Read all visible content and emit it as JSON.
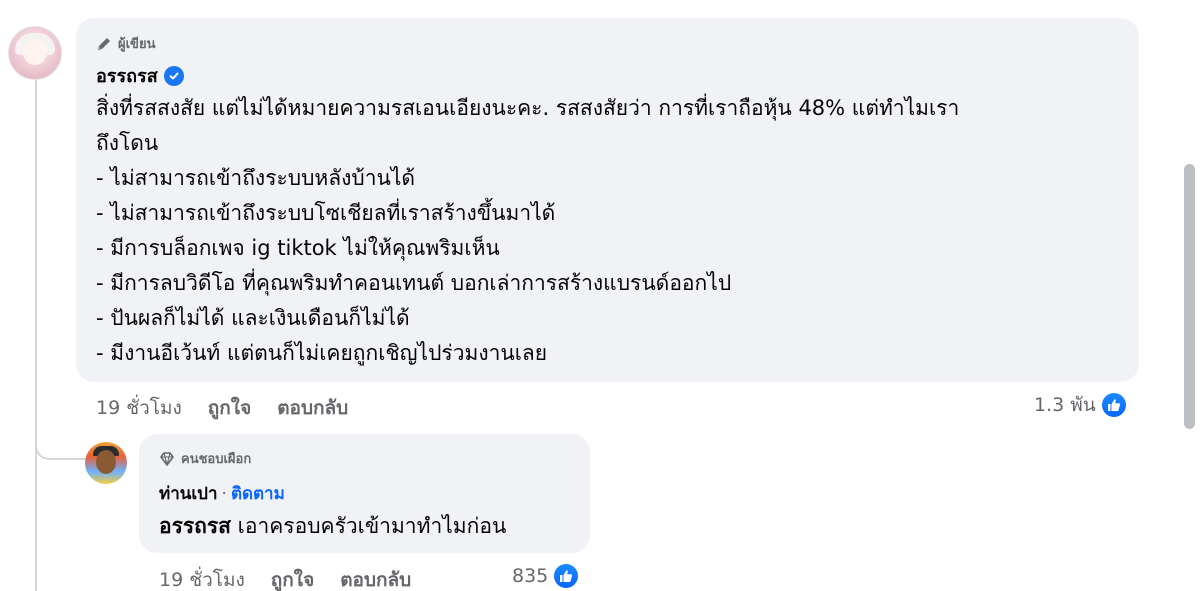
{
  "main_comment": {
    "badge": "ผู้เขียน",
    "author": "อรรถรส",
    "lines": [
      "สิ่งที่รสสงสัย แต่ไม่ได้หมายความรสเอนเอียงนะคะ. รสสงสัยว่า การที่เราถือหุ้น 48% แต่ทำไมเรา",
      "ถึงโดน",
      "- ไม่สามารถเข้าถึงระบบหลังบ้านได้",
      "- ไม่สามารถเข้าถึงระบบโซเชียลที่เราสร้างขึ้นมาได้",
      "- มีการบล็อกเพจ ig tiktok ไม่ให้คุณพริมเห็น",
      "- มีการลบวิดีโอ ที่คุณพริมทำคอนเทนต์ บอกเล่าการสร้างแบรนด์ออกไป",
      "- ปันผลก็ไม่ได้ และเงินเดือนก็ไม่ได้",
      "- มีงานอีเว้นท์ แต่ตนก็ไม่เคยถูกเชิญไปร่วมงานเลย"
    ],
    "time": "19 ชั่วโมง",
    "like_label": "ถูกใจ",
    "reply_label": "ตอบกลับ",
    "reaction_count": "1.3 พัน"
  },
  "reply_comment": {
    "badge": "คนชอบเผือก",
    "author": "ท่านเปา",
    "separator": "·",
    "follow_label": "ติดตาม",
    "mention": "อรรถรส",
    "text": "เอาครอบครัวเข้ามาทำไมก่อน",
    "time": "19 ชั่วโมง",
    "like_label": "ถูกใจ",
    "reply_label": "ตอบกลับ",
    "reaction_count": "835"
  },
  "icons": {
    "author_badge": "pencil-icon",
    "fan_badge": "diamond-icon",
    "verified": "verified-check-icon",
    "reaction": "thumbs-up-icon"
  },
  "colors": {
    "bubble": "#f0f2f5",
    "link": "#0866ff",
    "muted": "#65676b",
    "like": "#0866ff"
  }
}
